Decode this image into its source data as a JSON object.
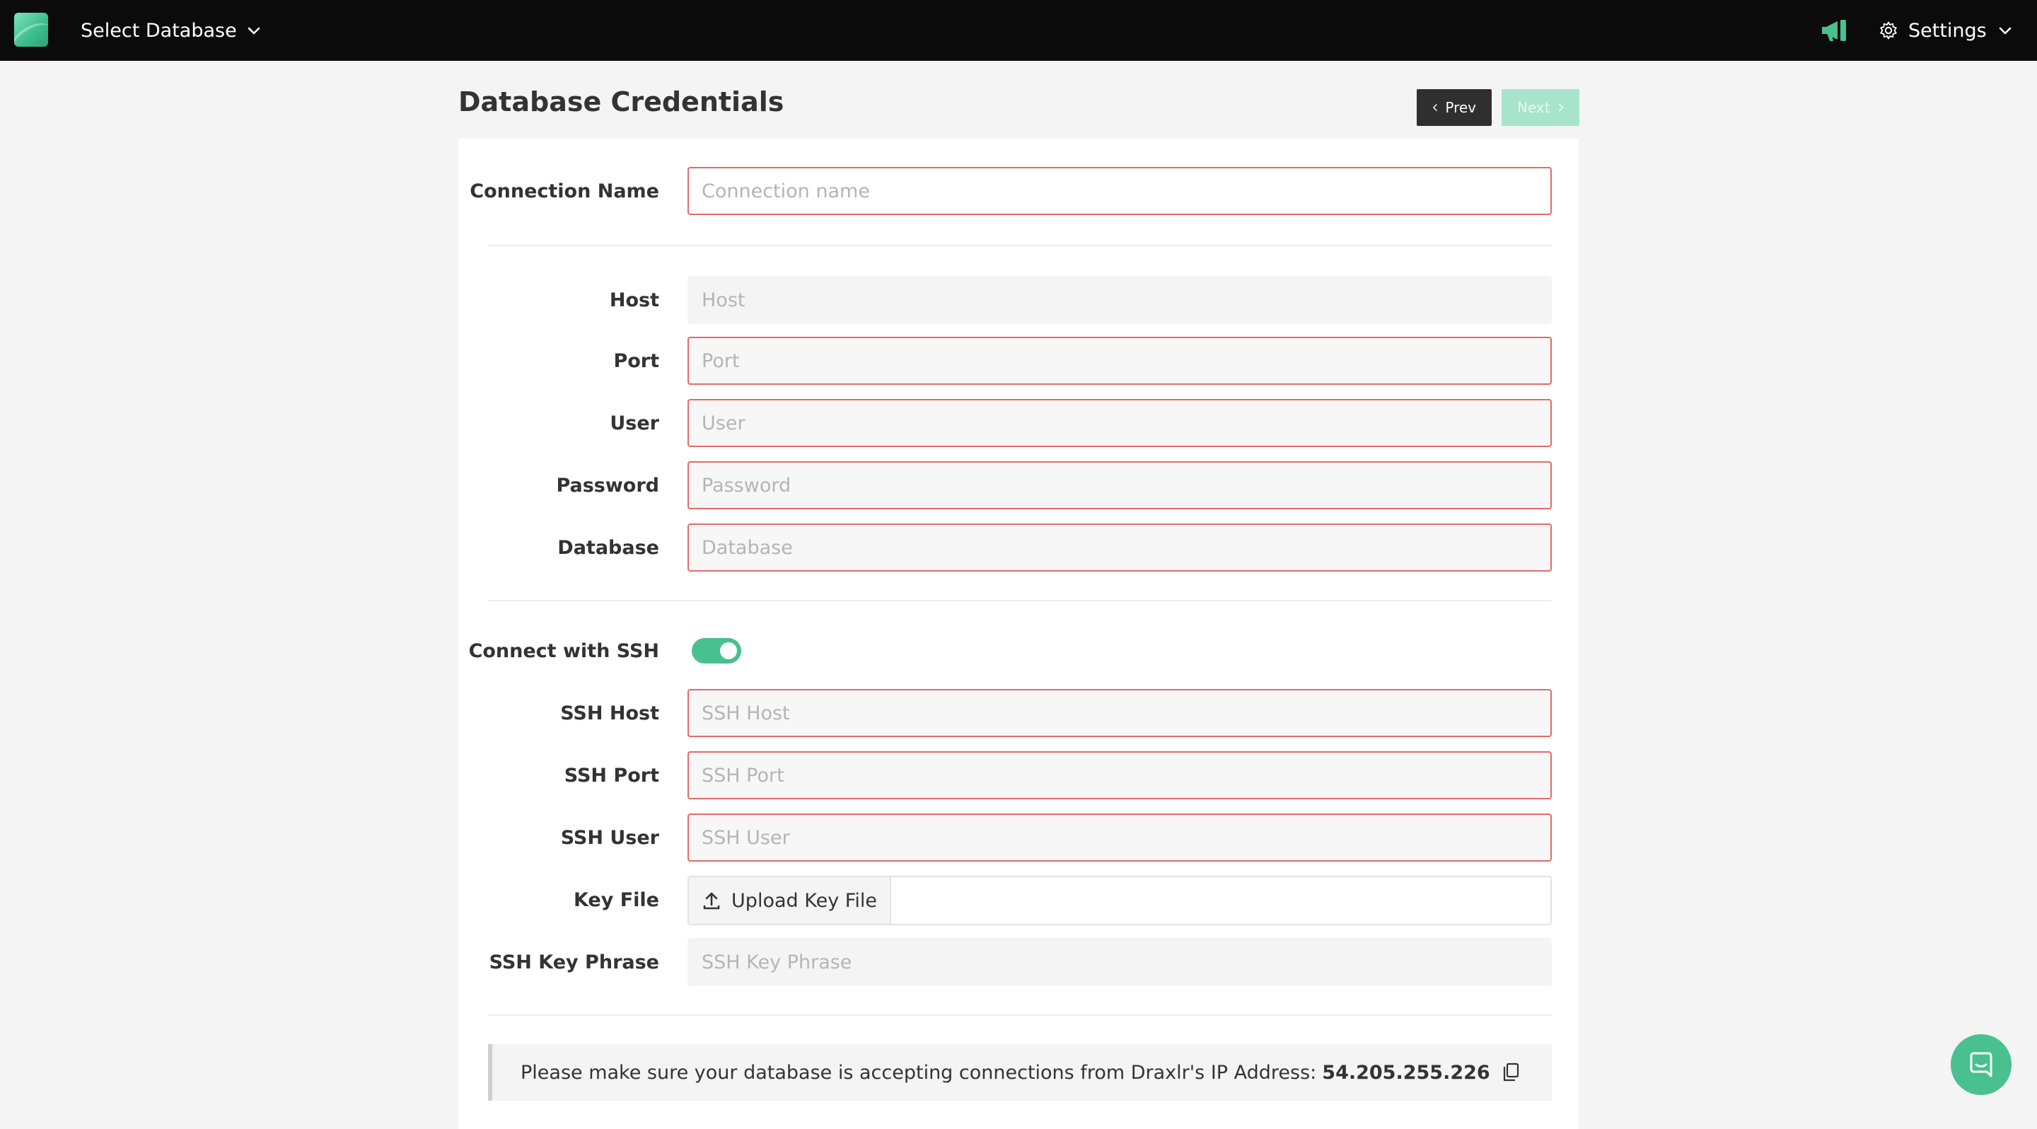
{
  "topbar": {
    "db_select_label": "Select Database",
    "settings_label": "Settings"
  },
  "header": {
    "title": "Database Credentials",
    "prev_label": "Prev",
    "next_label": "Next"
  },
  "form": {
    "connection_name": {
      "label": "Connection Name",
      "placeholder": "Connection name",
      "value": ""
    },
    "host": {
      "label": "Host",
      "placeholder": "Host",
      "value": ""
    },
    "port": {
      "label": "Port",
      "placeholder": "Port",
      "value": ""
    },
    "user": {
      "label": "User",
      "placeholder": "User",
      "value": ""
    },
    "password": {
      "label": "Password",
      "placeholder": "Password",
      "value": ""
    },
    "database": {
      "label": "Database",
      "placeholder": "Database",
      "value": ""
    },
    "ssh_toggle": {
      "label": "Connect with SSH",
      "enabled": true
    },
    "ssh_host": {
      "label": "SSH Host",
      "placeholder": "SSH Host",
      "value": ""
    },
    "ssh_port": {
      "label": "SSH Port",
      "placeholder": "SSH Port",
      "value": ""
    },
    "ssh_user": {
      "label": "SSH User",
      "placeholder": "SSH User",
      "value": ""
    },
    "key_file": {
      "label": "Key File",
      "upload_label": "Upload Key File"
    },
    "ssh_key_phrase": {
      "label": "SSH Key Phrase",
      "placeholder": "SSH Key Phrase",
      "value": ""
    }
  },
  "info": {
    "message": "Please make sure your database is accepting connections from Draxlr's IP Address:",
    "ip_address": "54.205.255.226"
  },
  "colors": {
    "accent": "#48c08f",
    "error_border": "#e26b6b",
    "topbar_bg": "#0b0b0b"
  },
  "icons": [
    "chevron-down-icon",
    "megaphone-icon",
    "gear-icon",
    "chevron-left-icon",
    "chevron-right-icon",
    "upload-icon",
    "copy-icon",
    "chat-icon"
  ]
}
